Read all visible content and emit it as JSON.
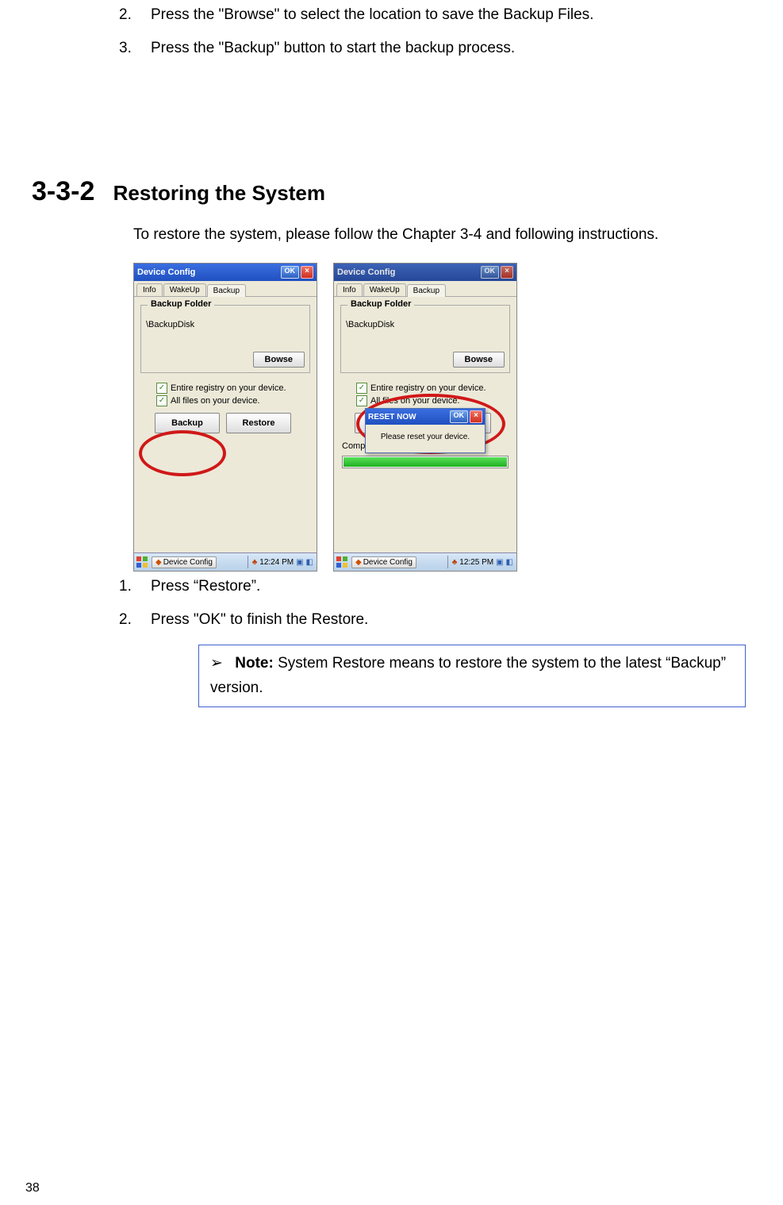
{
  "top_steps": [
    {
      "num": "2.",
      "text": "Press the \"Browse\" to select the location to save the Backup Files."
    },
    {
      "num": "3.",
      "text": "Press the \"Backup\" button to start the backup process."
    }
  ],
  "section": {
    "number": "3-3-2",
    "title": "Restoring the System",
    "intro": "To restore the system, please follow the Chapter 3-4 and following instructions."
  },
  "screenshot": {
    "window_title": "Device Config",
    "ok_label": "OK",
    "close_label": "×",
    "tabs": {
      "info": "Info",
      "wakeup": "WakeUp",
      "backup": "Backup"
    },
    "group_title": "Backup Folder",
    "folder_path": "\\BackupDisk",
    "browse_label": "Bowse",
    "check1": "Entire registry on your device.",
    "check2": "All files on your device.",
    "backup_btn": "Backup",
    "restore_btn": "Restore",
    "taskbar_task": "Device Config",
    "time1": "12:24 PM",
    "time2": "12:25 PM",
    "completed": "Completed.",
    "modal_title": "RESET NOW",
    "modal_ok": "OK",
    "modal_close": "×",
    "modal_body": "Please reset your device."
  },
  "bottom_steps": [
    {
      "num": "1.",
      "text": "Press “Restore”."
    },
    {
      "num": "2.",
      "text": "Press \"OK\" to finish the Restore."
    }
  ],
  "note": {
    "arrow": "➢",
    "label": "Note:",
    "text": " System Restore means to restore the system to the latest “Backup” version."
  },
  "page_number": "38"
}
